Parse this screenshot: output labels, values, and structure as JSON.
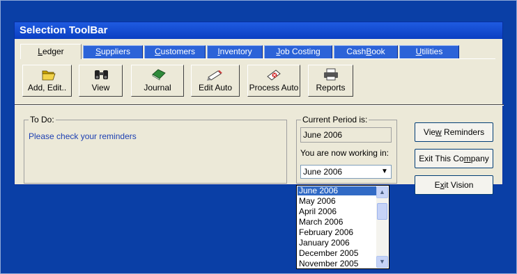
{
  "window": {
    "title": "Selection ToolBar"
  },
  "tabs": [
    {
      "label": "Ledger",
      "mnemonic": "L",
      "active": true
    },
    {
      "label": "Suppliers",
      "mnemonic": "S"
    },
    {
      "label": "Customers",
      "mnemonic": "C"
    },
    {
      "label": "Inventory",
      "mnemonic": "I"
    },
    {
      "label": "Job Costing",
      "mnemonic": "J"
    },
    {
      "label": "CashBook",
      "mnemonic": "B"
    },
    {
      "label": "Utilities",
      "mnemonic": "U"
    }
  ],
  "toolbar": {
    "buttons": [
      {
        "label": "Add, Edit..",
        "icon": "folder-open-icon"
      },
      {
        "label": "View",
        "icon": "binoculars-icon"
      },
      {
        "label": "Journal",
        "icon": "journal-book-icon"
      },
      {
        "label": "Edit Auto",
        "icon": "pencil-icon"
      },
      {
        "label": "Process Auto",
        "icon": "process-icon"
      },
      {
        "label": "Reports",
        "icon": "printer-icon"
      }
    ]
  },
  "todo": {
    "title": "To Do:",
    "message": "Please check your reminders"
  },
  "period": {
    "title": "Current Period is:",
    "current": "June 2006",
    "working_label": "You are now working in:",
    "selected": "June 2006",
    "options": [
      "June 2006",
      "May 2006",
      "April 2006",
      "March 2006",
      "February 2006",
      "January 2006",
      "December 2005",
      "November 2005"
    ]
  },
  "side_buttons": {
    "view_reminders": "View Reminders",
    "exit_company": "Exit This Company",
    "exit_vision": "Exit Vision"
  },
  "colors": {
    "desktop": "#0a3fa6",
    "titlebar": "#0a3ec2",
    "panel": "#ece9d8",
    "selection": "#316ac5",
    "link_text": "#1c3fb2"
  }
}
